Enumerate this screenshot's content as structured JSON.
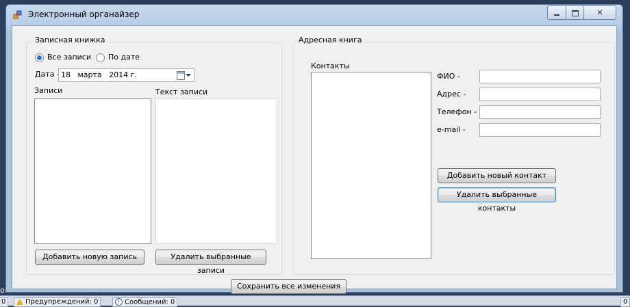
{
  "window": {
    "title": "Электронный органайзер",
    "min_glyph": "▭",
    "max_glyph": "▢",
    "close_glyph": "✕"
  },
  "notebook": {
    "group_label": "Записная книжка",
    "radio_all": "Все записи",
    "radio_by_date": "По дате",
    "selected_filter": "Все записи",
    "date_label": "Дата -",
    "date_value": "18   марта   2014 г.",
    "entries_label": "Записи",
    "text_label": "Текст записи",
    "add_button": "Добавить новую запись",
    "delete_button": "Удалить выбранные записи"
  },
  "addressbook": {
    "group_label": "Адресная книга",
    "contacts_label": "Контакты",
    "fio_label": "ФИО -",
    "address_label": "Адрес -",
    "phone_label": "Телефон -",
    "email_label": "e-mail -",
    "fio_value": "",
    "address_value": "",
    "phone_value": "",
    "email_value": "",
    "add_button": "Добавить новый контакт",
    "delete_button": "Удалить выбранные контакты"
  },
  "save_button": "Сохранить все изменения",
  "statusbar": {
    "left_text": "ок",
    "count_left": "0",
    "warnings": "Предупреждений: 0",
    "messages": "Сообщений: 0",
    "count_right": "0",
    "info_glyph": "i"
  },
  "colors": {
    "accent": "#2a7bd0",
    "warning": "#e2b21a",
    "client_bg": "#f0f0f0"
  }
}
